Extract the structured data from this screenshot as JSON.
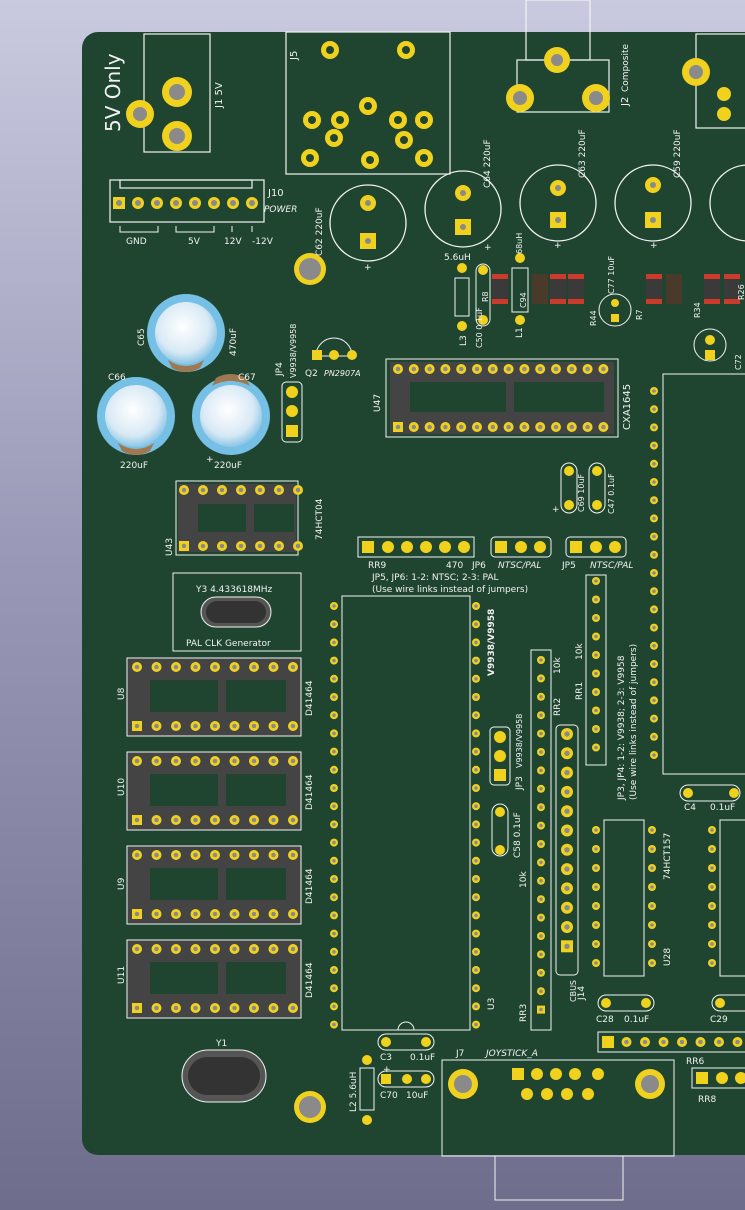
{
  "board": {
    "color": "#1f4530",
    "silk_color": "#f2f2f2",
    "pad_color": "#f0d21e"
  },
  "texts": {
    "only5v": "5V Only",
    "j1": "J1 5V",
    "j5": "J5",
    "j2": "J2",
    "composite": "Composite",
    "j10": "J10",
    "power": "POWER",
    "gnd": "GND",
    "v5": "5V",
    "v12": "12V",
    "vm12": "-12V",
    "c62": "C62 220uF",
    "c64": "C64 220uF",
    "c63": "C63 220uF",
    "c59": "C59 220uF",
    "l3val": "5.6uH",
    "r8": "R8",
    "l3": "L3",
    "c50": "C50 0.1uF",
    "l1val": "68uH",
    "c94": "C94",
    "l1": "L1",
    "r44": "R44",
    "c77": "C77 10uF",
    "r7": "R7",
    "r34": "R34",
    "r26": "R26",
    "c72": "C72",
    "c65": "C65",
    "c65val": "470uF",
    "jp4": "JP4",
    "jp4val": "V9938/V9958",
    "q2": "Q2",
    "q2val": "PN2907A",
    "u47": "U47",
    "cxa": "CXA1645",
    "c66": "C66",
    "c67": "C67",
    "c66val": "220uF",
    "c67val": "220uF",
    "c69": "C69 10uF",
    "c47": "C47 0.1uF",
    "u43": "U43",
    "u43val": "74HCT04",
    "rr9": "RR9",
    "rr9val": "470",
    "jp6": "JP6",
    "jp6val": "NTSC/PAL",
    "jp5": "JP5",
    "jp5val": "NTSC/PAL",
    "jpnote1": "JP5, JP6: 1-2: NTSC;  2-3: PAL",
    "jpnote2": "(Use wire links instead of jumpers)",
    "y3": "Y3  4.433618MHz",
    "palclk": "PAL CLK Generator",
    "v9938": "V9938/V9958",
    "rr2": "RR2",
    "rr2val": "10k",
    "rr1": "RR1",
    "rr1val": "10k",
    "jp3note1": "JP3, JP4: 1-2: V9938; 2-3: V9958",
    "jp3note2": "(Use wire links instead of jumpers)",
    "u8": "U8",
    "u10": "U10",
    "u9": "U9",
    "u11": "U11",
    "d41464": "D41464",
    "jp3": "JP3",
    "jp3val": "V9938/V9958",
    "c58": "C58 0.1uF",
    "j14": "J14",
    "cbus": "CBUS",
    "rr10k": "10k",
    "rr3": "RR3",
    "u3": "U3",
    "c4": "C4",
    "c4val": "0.1uF",
    "hc157": "74HCT157",
    "u28": "U28",
    "c28": "C28",
    "c28val": "0.1uF",
    "c29": "C29",
    "y1": "Y1",
    "c3": "C3",
    "c3val": "0.1uF",
    "l2": "L2 5.6uH",
    "c70": "C70",
    "c70val": "10uF",
    "j7": "J7",
    "joystick": "JOYSTICK_A",
    "rr6": "RR6",
    "rr8": "RR8",
    "plus": "+"
  }
}
